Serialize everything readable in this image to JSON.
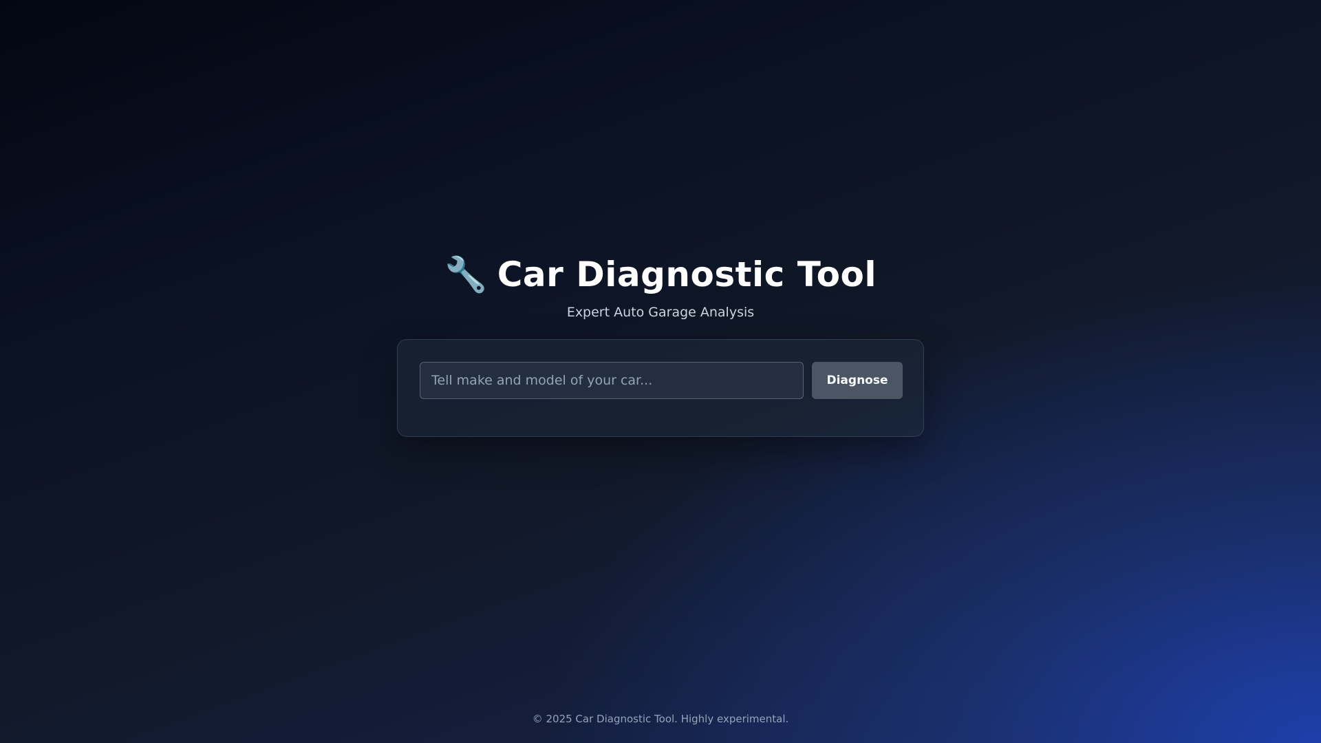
{
  "header": {
    "icon": "wrench-icon",
    "icon_glyph": "🔧",
    "title": "Car Diagnostic Tool",
    "subtitle": "Expert Auto Garage Analysis"
  },
  "search": {
    "value": "",
    "placeholder": "Tell make and model of your car..."
  },
  "actions": {
    "diagnose_label": "Diagnose"
  },
  "footer": {
    "text": "© 2025 Car Diagnostic Tool. Highly experimental."
  },
  "colors": {
    "button_bg": "#4b5563",
    "accent_blue": "#1e40af"
  }
}
